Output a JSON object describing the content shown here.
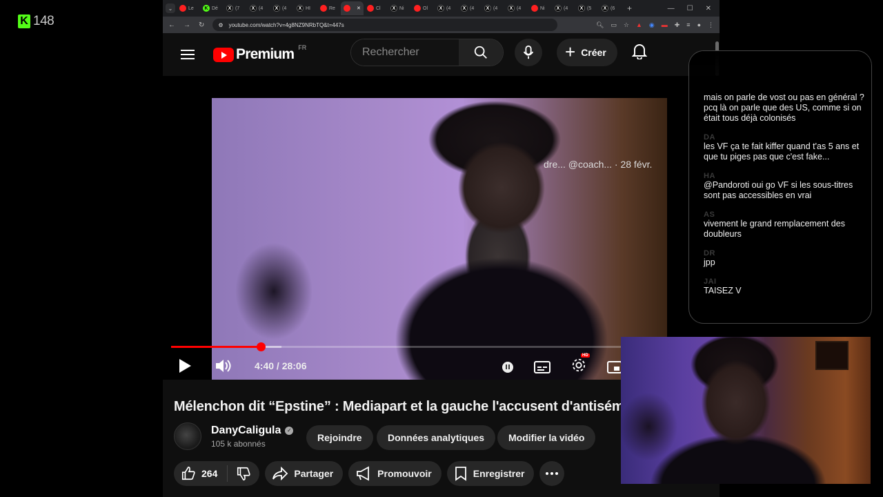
{
  "kick": {
    "viewer_count": "148"
  },
  "browser": {
    "tabs": [
      {
        "icon": "yt",
        "label": "Le"
      },
      {
        "icon": "kick",
        "label": "Dé"
      },
      {
        "icon": "x",
        "label": "(7"
      },
      {
        "icon": "x",
        "label": "(4"
      },
      {
        "icon": "x",
        "label": "(4"
      },
      {
        "icon": "x",
        "label": "HI"
      },
      {
        "icon": "yt",
        "label": "Re"
      },
      {
        "icon": "yt",
        "label": "",
        "active": true
      },
      {
        "icon": "yt",
        "label": "Cl"
      },
      {
        "icon": "x",
        "label": "Ni"
      },
      {
        "icon": "yt",
        "label": "Ol"
      },
      {
        "icon": "x",
        "label": "(4"
      },
      {
        "icon": "x",
        "label": "(4"
      },
      {
        "icon": "x",
        "label": "(4"
      },
      {
        "icon": "x",
        "label": "(4"
      },
      {
        "icon": "yt",
        "label": "Ni"
      },
      {
        "icon": "x",
        "label": "(4"
      },
      {
        "icon": "x",
        "label": "(5"
      },
      {
        "icon": "x",
        "label": "(6"
      }
    ],
    "url": "youtube.com/watch?v=4g8NZ9NRbTQ&t=447s"
  },
  "youtube": {
    "logo_text": "Premium",
    "region": "FR",
    "search_placeholder": "Rechercher",
    "create_label": "Créer",
    "video": {
      "overlay_text": "dre... @coach... · 28 févr.",
      "current_time": "4:40",
      "duration": "28:06",
      "time_display": "4:40 / 28:06",
      "progress_fraction": 0.166,
      "buffered_fraction": 0.204,
      "title": "Mélenchon dit “Epstine” : Mediapart et la gauche l'accusent d'antisémit",
      "accent_color": "#ff0000"
    },
    "channel": {
      "name": "DanyCaligula",
      "subscribers": "105 k abonnés",
      "join_label": "Rejoindre",
      "analytics_label": "Données analytiques",
      "edit_label": "Modifier la vidéo"
    },
    "actions": {
      "likes": "264",
      "share": "Partager",
      "promote": "Promouvoir",
      "save": "Enregistrer"
    }
  },
  "chat": {
    "messages": [
      {
        "user": "",
        "text": "mais on parle de vost ou pas en général ? pcq là on parle que des US, comme si on était tous déjà colonisés"
      },
      {
        "user": "DA",
        "text": "les VF ça te fait kiffer quand t'as 5 ans et que tu piges pas que c'est fake..."
      },
      {
        "user": "HA",
        "text": "@Pandoroti oui go VF si les sous-titres sont pas accessibles en vrai"
      },
      {
        "user": "AS",
        "text": "vivement le grand remplacement des doubleurs"
      },
      {
        "user": "DR",
        "text": "jpp"
      },
      {
        "user": "JAI",
        "text": "TAISEZ V"
      }
    ]
  }
}
